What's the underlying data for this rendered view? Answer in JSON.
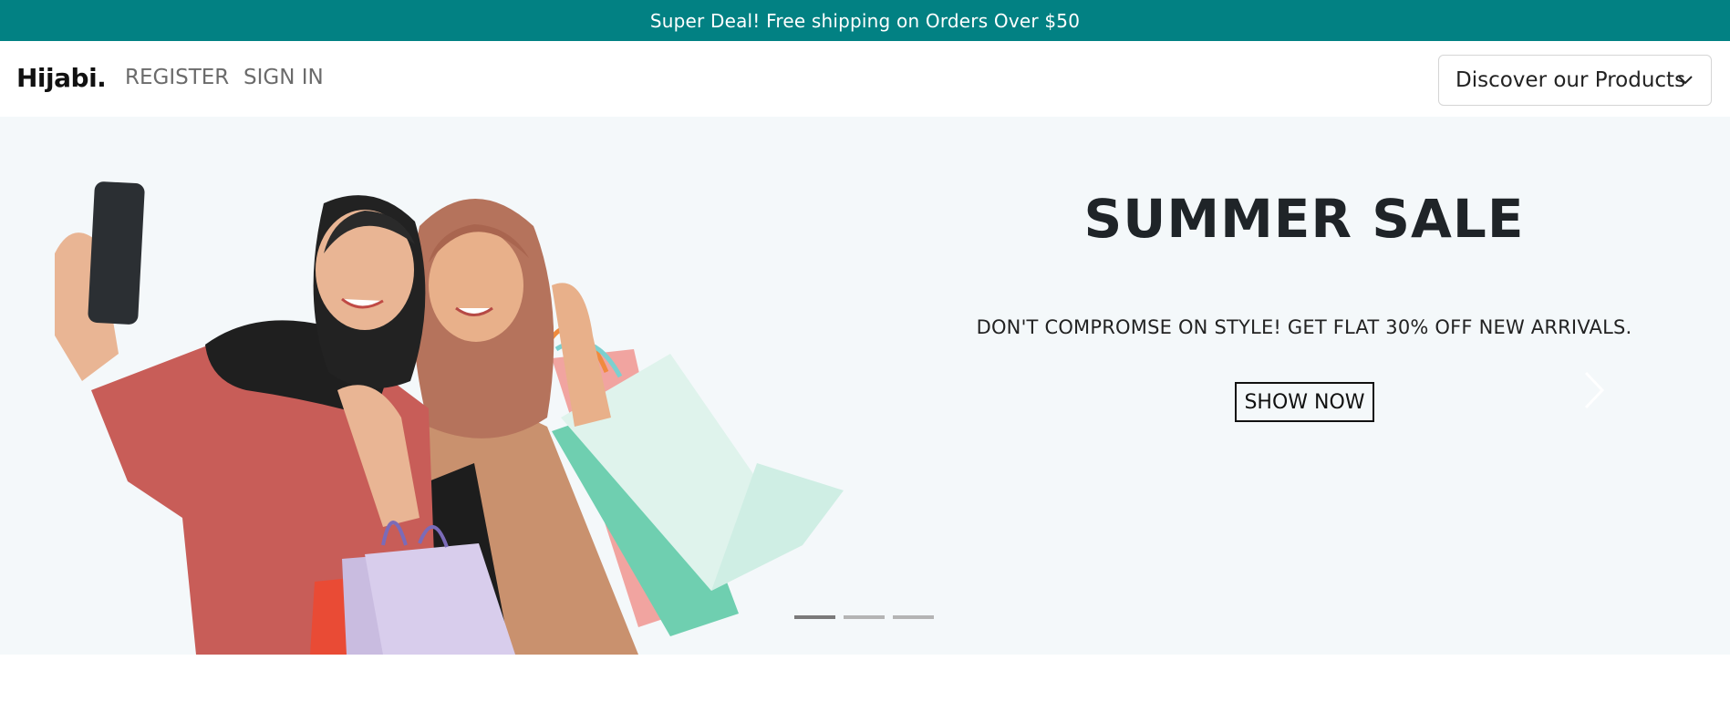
{
  "announcement": "Super Deal! Free shipping on Orders Over $50",
  "nav": {
    "brand": "Hijabi.",
    "register": "REGISTER",
    "sign_in": "SIGN IN",
    "discover": "Discover our Products",
    "discover_icon": "chevron-down-icon"
  },
  "hero": {
    "title": "SUMMER SALE",
    "subtitle": "DON'T COMPROMSE ON STYLE! GET FLAT 30% OFF NEW ARRIVALS.",
    "button": "SHOW NOW",
    "next_icon": "chevron-right-icon",
    "active_slide": 1,
    "slide_count": 3
  },
  "colors": {
    "announcement_bg": "#028183",
    "hero_bg": "#f4f8fa"
  }
}
